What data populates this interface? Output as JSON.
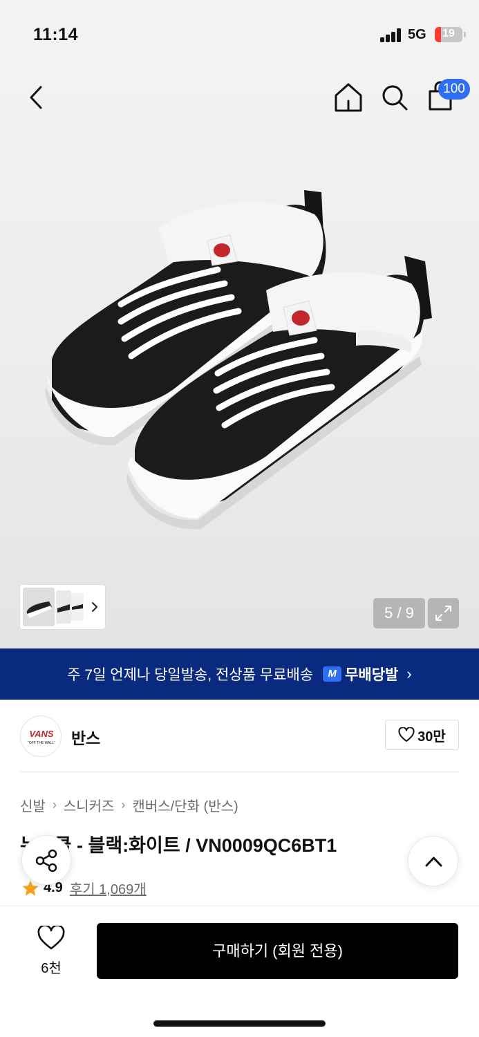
{
  "status_bar": {
    "time": "11:14",
    "network": "5G",
    "battery_level": "19"
  },
  "header": {
    "cart_count": "100"
  },
  "gallery": {
    "counter": "5 / 9"
  },
  "banner": {
    "text": "주 7일 언제나 당일발송, 전상품 무료배송",
    "logo_letter": "M",
    "brand": "무배당발",
    "chevron": "›"
  },
  "brand": {
    "name": "반스",
    "logo_text": "VANS",
    "logo_subtext": "\"OFF THE WALL\"",
    "likes": "30만"
  },
  "breadcrumb": {
    "items": [
      "신발",
      "스니커즈",
      "캔버스/단화 (반스)"
    ],
    "separator": "›"
  },
  "product": {
    "title": "뉴스쿨 - 블랙:화이트 / VN0009QC6BT1",
    "rating": "4.9",
    "reviews": "후기 1,069개"
  },
  "bottom_bar": {
    "like_count": "6천",
    "buy_label": "구매하기 (회원 전용)"
  },
  "colors": {
    "banner_bg": "#0a2a80",
    "accent_blue": "#2f6ef0",
    "buy_bg": "#000000",
    "star": "#f7a21b"
  },
  "icons": [
    "back-arrow-icon",
    "home-icon",
    "search-icon",
    "cart-icon",
    "chevron-right-icon",
    "expand-icon",
    "heart-icon",
    "share-icon",
    "chevron-up-icon",
    "star-icon"
  ]
}
